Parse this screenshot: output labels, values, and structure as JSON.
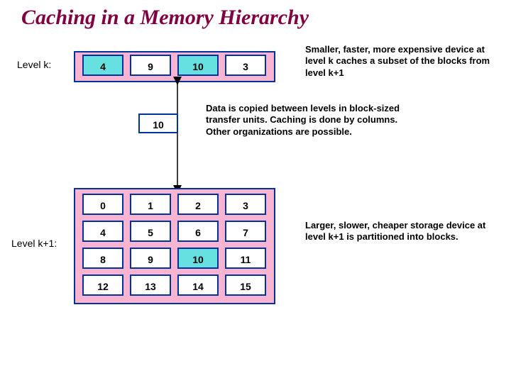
{
  "title": "Caching in a Memory Hierarchy",
  "labels": {
    "level_k": "Level k:",
    "level_k1": "Level k+1:"
  },
  "notes": {
    "top": "Smaller, faster, more expensive device at level k caches a subset of the blocks from level k+1",
    "mid": "Data is copied between levels in block-sized transfer units. Caching is done by columns. Other organizations are possible.",
    "bottom": "Larger, slower, cheaper storage device at level k+1 is partitioned into blocks."
  },
  "cache": [
    "4",
    "9",
    "10",
    "3"
  ],
  "cache_highlight": [
    0,
    2
  ],
  "transfer_block": "10",
  "memory": [
    [
      "0",
      "1",
      "2",
      "3"
    ],
    [
      "4",
      "5",
      "6",
      "7"
    ],
    [
      "8",
      "9",
      "10",
      "11"
    ],
    [
      "12",
      "13",
      "14",
      "15"
    ]
  ],
  "memory_highlight": "10"
}
